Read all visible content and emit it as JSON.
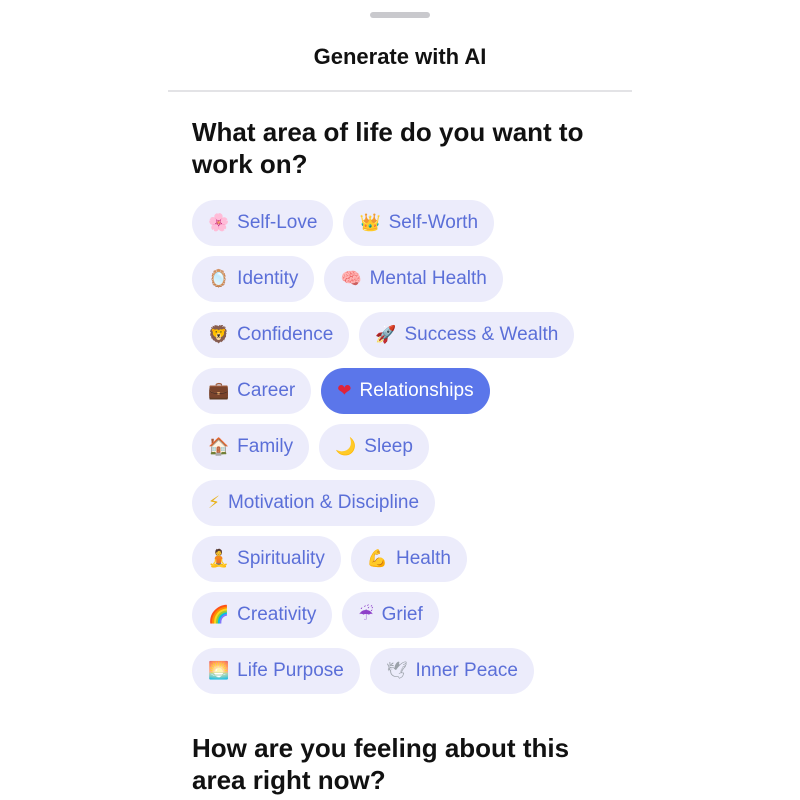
{
  "header": {
    "title": "Generate with AI"
  },
  "questions": {
    "area": "What area of life do you want to work on?",
    "feeling": "How are you feeling about this area right now?"
  },
  "colors": {
    "chip_bg": "#ececfb",
    "chip_text": "#5b6fd8",
    "selected_bg": "#5b76ea",
    "selected_text": "#ffffff"
  },
  "areas": [
    {
      "emoji": "🌸",
      "label": "Self-Love",
      "icon": "cherry-blossom-icon"
    },
    {
      "emoji": "👑",
      "label": "Self-Worth",
      "icon": "crown-icon"
    },
    {
      "emoji": "🪞",
      "label": "Identity",
      "icon": "mirror-icon"
    },
    {
      "emoji": "🧠",
      "label": "Mental Health",
      "icon": "brain-icon"
    },
    {
      "emoji": "🦁",
      "label": "Confidence",
      "icon": "lion-icon"
    },
    {
      "emoji": "🚀",
      "label": "Success & Wealth",
      "icon": "rocket-icon"
    },
    {
      "emoji": "💼",
      "label": "Career",
      "icon": "briefcase-icon"
    },
    {
      "emoji": "❤",
      "label": "Relationships",
      "icon": "heart-icon",
      "selected": true
    },
    {
      "emoji": "🏠",
      "label": "Family",
      "icon": "house-icon"
    },
    {
      "emoji": "🌙",
      "label": "Sleep",
      "icon": "moon-icon"
    },
    {
      "emoji": "⚡",
      "label": "Motivation & Discipline",
      "icon": "lightning-icon"
    },
    {
      "emoji": "🧘",
      "label": "Spirituality",
      "icon": "meditation-icon"
    },
    {
      "emoji": "💪",
      "label": "Health",
      "icon": "flexed-biceps-icon"
    },
    {
      "emoji": "🌈",
      "label": "Creativity",
      "icon": "rainbow-icon"
    },
    {
      "emoji": "☔",
      "label": "Grief",
      "icon": "umbrella-rain-icon"
    },
    {
      "emoji": "🌅",
      "label": "Life Purpose",
      "icon": "sunrise-icon"
    },
    {
      "emoji": "🕊",
      "label": "Inner Peace",
      "icon": "dove-icon"
    }
  ]
}
